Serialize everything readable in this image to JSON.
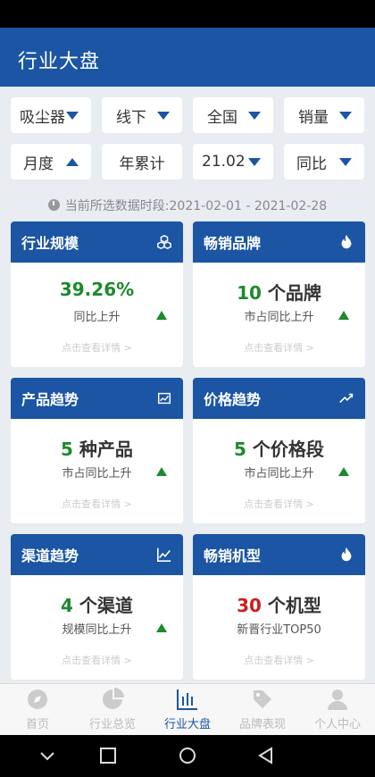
{
  "header": {
    "title": "行业大盘"
  },
  "filters": {
    "category": "吸尘器",
    "channel": "线下",
    "region": "全国",
    "metric": "销量",
    "granularity": "月度",
    "cumulative": "年累计",
    "month": "21.02",
    "compare": "同比"
  },
  "period_text": "当前所选数据时段:2021-02-01 - 2021-02-28",
  "cards": [
    {
      "title": "行业规模",
      "icon": "cubes-icon",
      "value": "39.26%",
      "unit": "",
      "sub": "同比上升",
      "link": "点击查看详情 >"
    },
    {
      "title": "畅销品牌",
      "icon": "fire-icon",
      "value": "10",
      "unit": " 个品牌",
      "sub": "市占同比上升",
      "link": "点击查看详情 >"
    },
    {
      "title": "产品趋势",
      "icon": "area-chart-icon",
      "value": "5",
      "unit": " 种产品",
      "sub": "市占同比上升",
      "link": "点击查看详情 >"
    },
    {
      "title": "价格趋势",
      "icon": "trend-up-icon",
      "value": "5",
      "unit": " 个价格段",
      "sub": "市占同比上升",
      "link": "点击查看详情 >"
    },
    {
      "title": "渠道趋势",
      "icon": "line-chart-icon",
      "value": "4",
      "unit": " 个渠道",
      "sub": "规模同比上升",
      "link": "点击查看详情 >"
    },
    {
      "title": "畅销机型",
      "icon": "fire-icon",
      "value": "30",
      "unit": " 个机型",
      "sub": "新晋行业TOP50",
      "link": "点击查看详情 >"
    }
  ],
  "tabs": [
    {
      "label": "首页",
      "icon": "compass-icon"
    },
    {
      "label": "行业总览",
      "icon": "pie-chart-icon"
    },
    {
      "label": "行业大盘",
      "icon": "bar-chart-icon"
    },
    {
      "label": "品牌表现",
      "icon": "tag-icon"
    },
    {
      "label": "个人中心",
      "icon": "user-icon"
    }
  ],
  "colors": {
    "primary": "#1b55a4",
    "up": "#1d8a2c",
    "highlight": "#cc1f1f"
  }
}
